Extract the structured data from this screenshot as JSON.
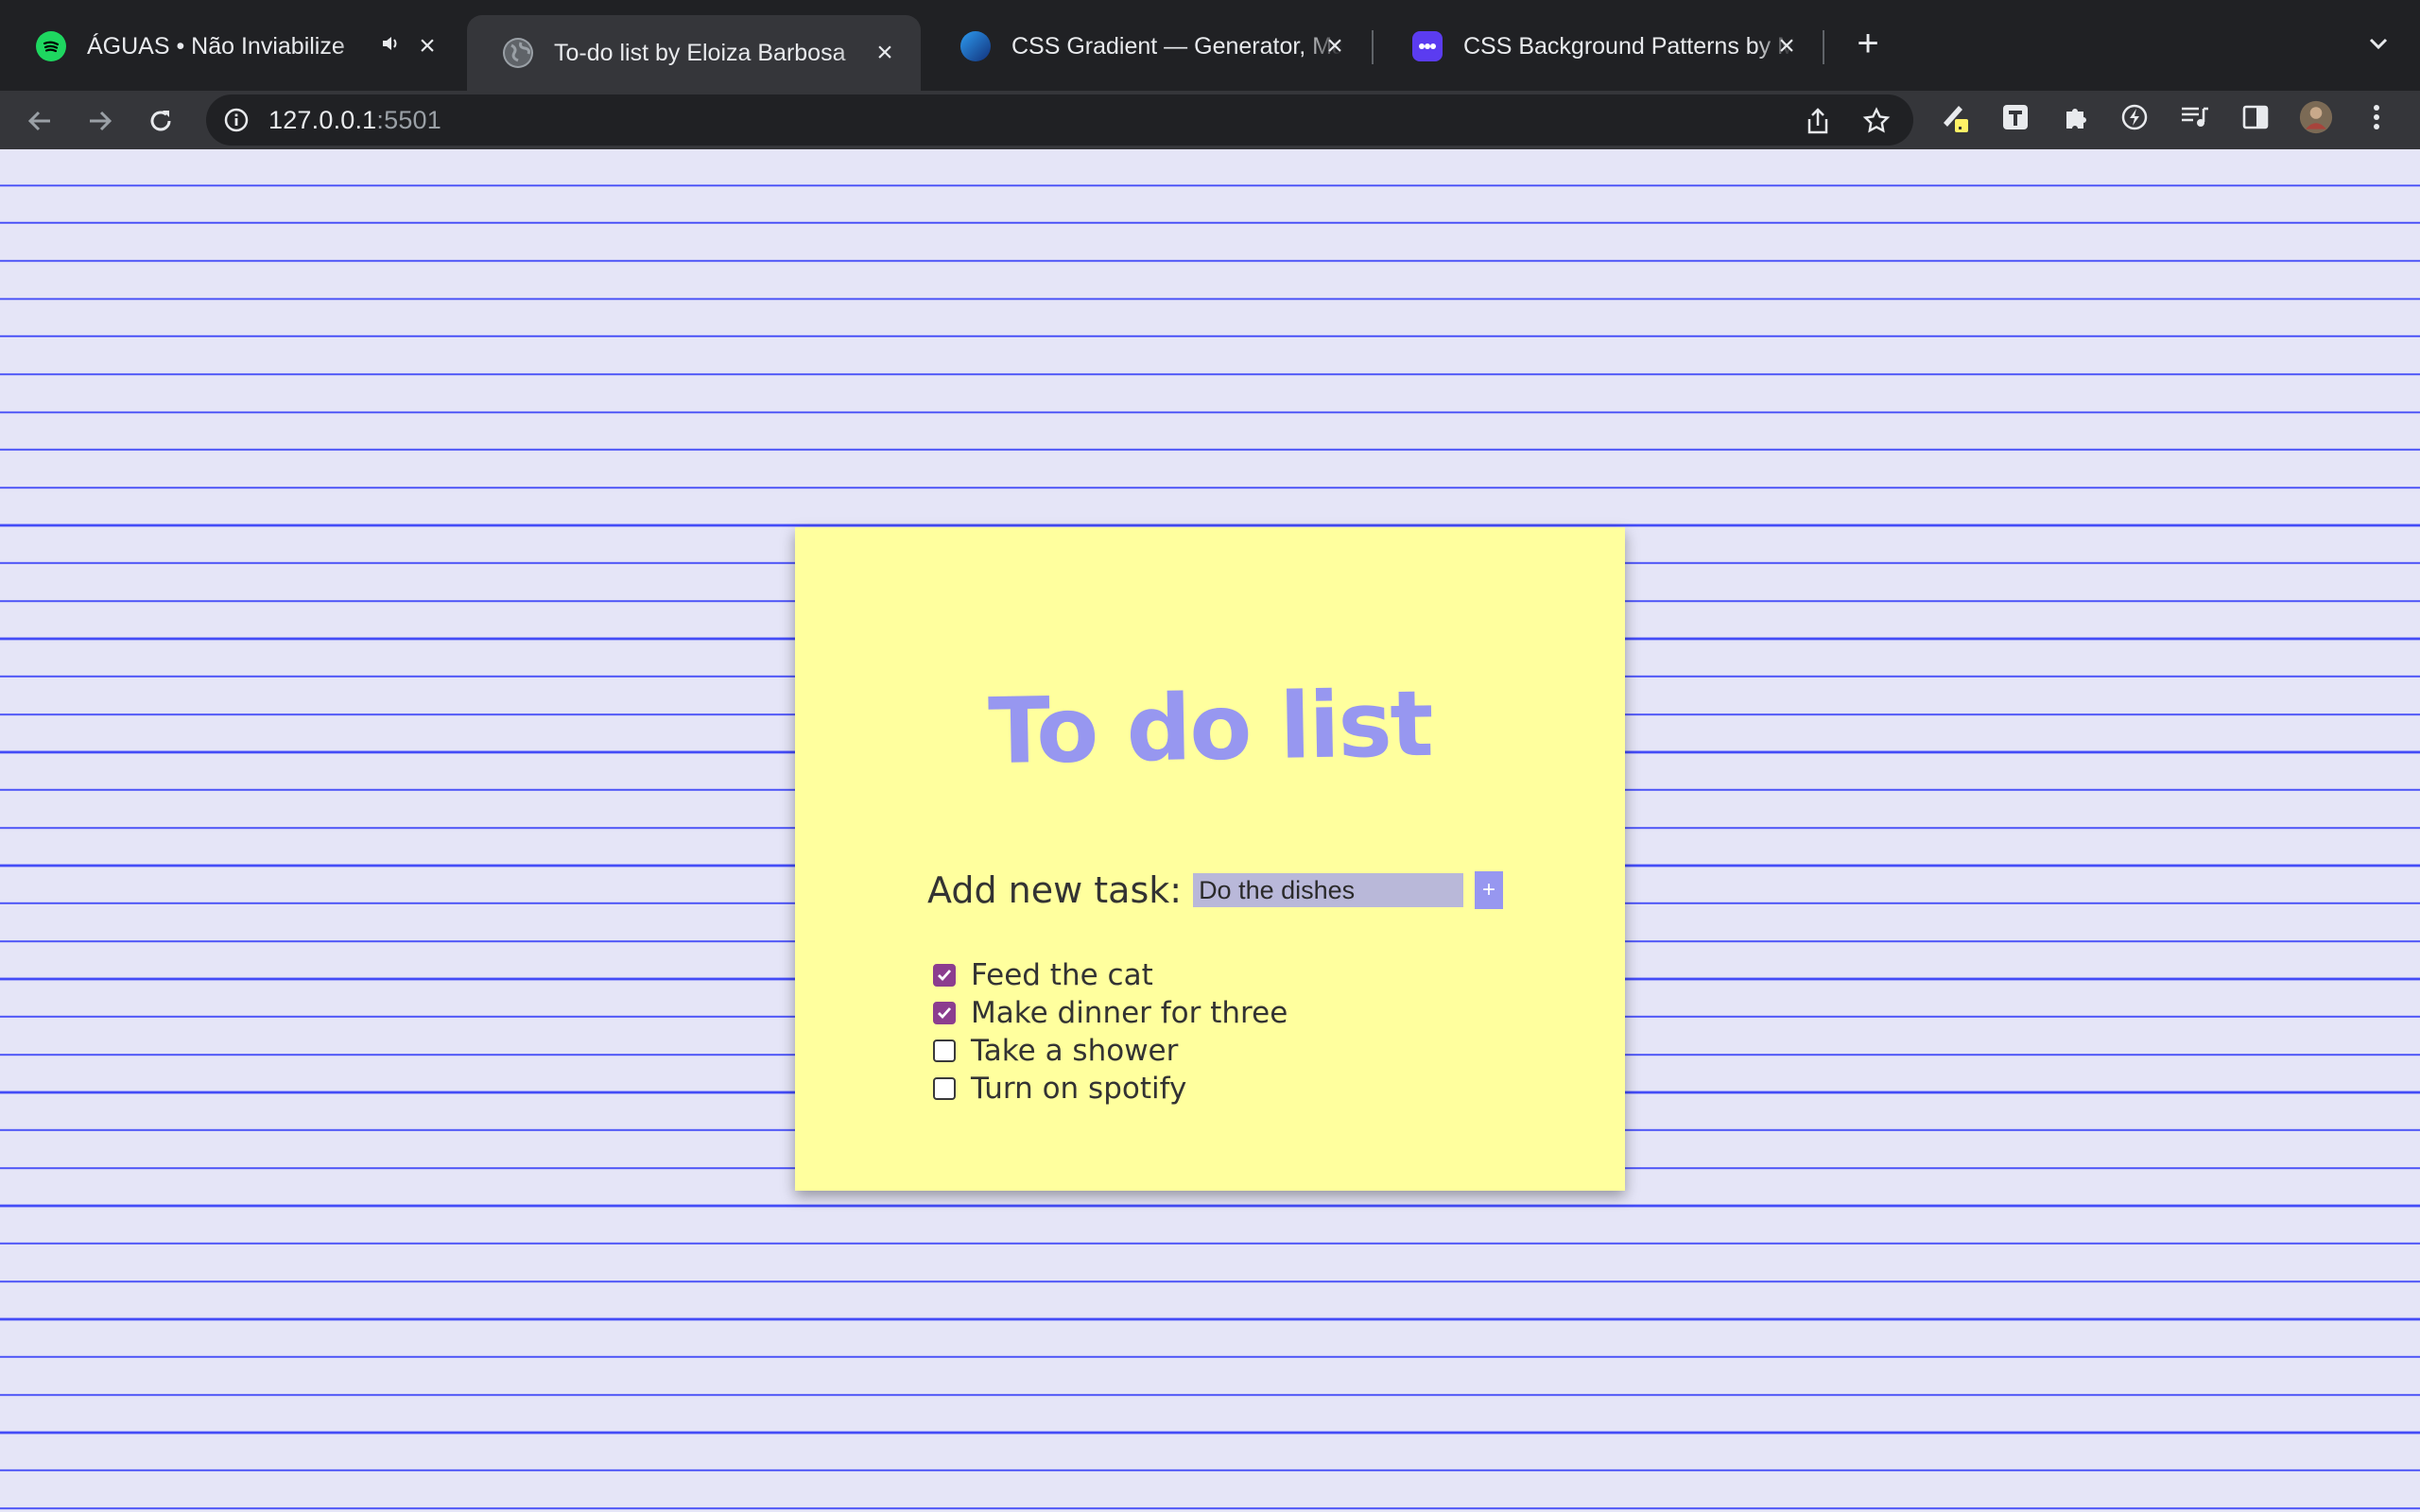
{
  "browser": {
    "tabs": [
      {
        "title": "ÁGUAS • Não Inviabilize",
        "favicon": "spotify-icon",
        "audio": true,
        "active": false
      },
      {
        "title": "To-do list by Eloiza Barbosa",
        "favicon": "globe-icon",
        "active": true
      },
      {
        "title": "CSS Gradient — Generator, Maker, and Background",
        "favicon": "css-gradient-icon",
        "active": false
      },
      {
        "title": "CSS Background Patterns by MagicPattern",
        "favicon": "magicpattern-icon",
        "active": false
      }
    ],
    "url_host": "127.0.0.1",
    "url_port": ":5501"
  },
  "page": {
    "title": "To do list",
    "add_label": "Add new task:",
    "input_value": "Do the dishes",
    "add_button": "+",
    "tasks": [
      {
        "label": "Feed the cat",
        "done": true
      },
      {
        "label": "Make dinner for three",
        "done": true
      },
      {
        "label": "Take a shower",
        "done": false
      },
      {
        "label": "Turn on spotify",
        "done": false
      }
    ]
  },
  "colors": {
    "page_bg": "#e5e5f7",
    "ruled_line": "#444cf7",
    "note": "#ffff9e",
    "title": "#9797f0",
    "checkbox_checked": "#8c3d8f",
    "tabbar": "#202124",
    "toolbar": "#35363a"
  }
}
